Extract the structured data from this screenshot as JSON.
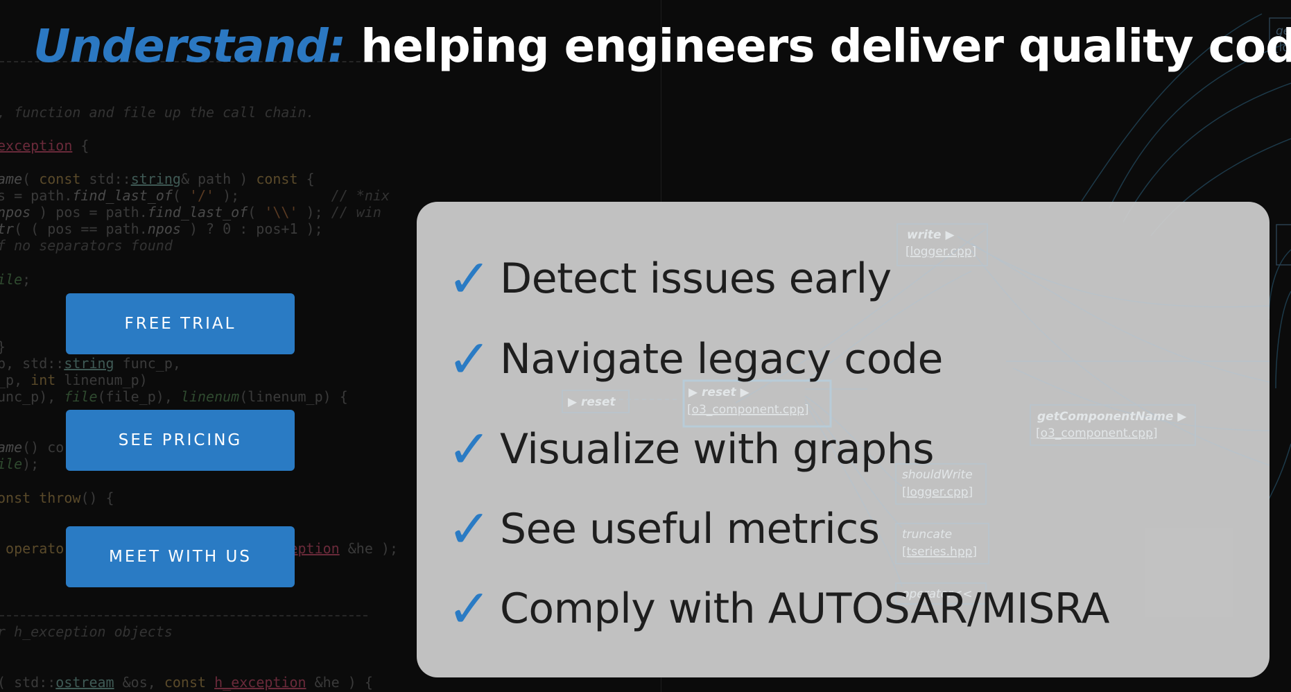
{
  "title": {
    "brand": "Understand:",
    "text": "helping engineers deliver quality code"
  },
  "buttons": {
    "free_trial": "FREE TRIAL",
    "see_pricing": "SEE PRICING",
    "meet_with_us": "MEET WITH US"
  },
  "features": [
    {
      "icon": "checkmark-icon",
      "text": "Detect issues early"
    },
    {
      "icon": "checkmark-icon",
      "text": "Navigate legacy code"
    },
    {
      "icon": "checkmark-icon",
      "text": "Visualize with graphs"
    },
    {
      "icon": "checkmark-icon",
      "text": "See useful metrics"
    },
    {
      "icon": "checkmark-icon",
      "text": "Comply with AUTOSAR/MISRA"
    }
  ],
  "graph_nodes": [
    {
      "name": "write ▶",
      "file": "[logger.cpp]"
    },
    {
      "name": "▶ reset",
      "file": ""
    },
    {
      "name": "▶ reset ▶",
      "file": "[o3_component.cpp]"
    },
    {
      "name": "getComponentName ▶",
      "file": "[o3_component.cpp]"
    },
    {
      "name": "shouldWrite",
      "file": "[logger.cpp]"
    },
    {
      "name": "truncate",
      "file": "[tseries.hpp]"
    },
    {
      "name": "operator<<",
      "file": ""
    },
    {
      "name": "ge",
      "file": "[lo"
    }
  ],
  "colors": {
    "accent": "#2a7bc4",
    "background": "#0b0b0b",
    "panel": "#cdcdcd"
  }
}
